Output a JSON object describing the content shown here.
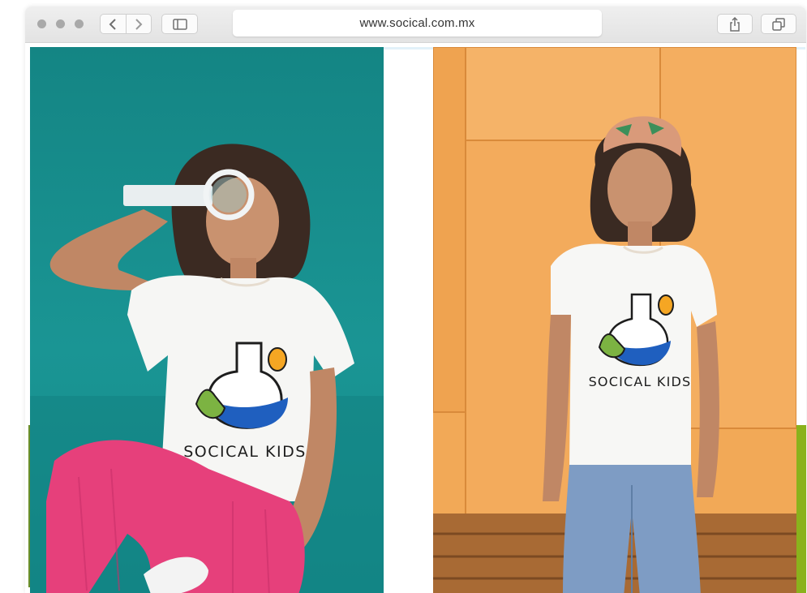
{
  "browser": {
    "url": "www.socical.com.mx",
    "icons": {
      "back": "chevron-left-icon",
      "forward": "chevron-right-icon",
      "sidebar": "sidebar-icon",
      "share": "share-icon",
      "tabs": "tabs-icon"
    }
  },
  "photos": [
    {
      "name": "girl-with-magnifier-teal-background",
      "background_color": "#148584",
      "shirt_logo_text": "SOCICAL KIDS"
    },
    {
      "name": "girl-with-bandana-orange-background",
      "background_color": "#f2a957",
      "shirt_logo_text": "SOCICAL KIDS"
    }
  ],
  "colors": {
    "teal": "#148584",
    "orange": "#f2a957",
    "logo_blue": "#1f5fbf",
    "logo_green": "#7cb342",
    "logo_orange": "#f5a623",
    "pants_pink": "#e6407b",
    "jeans_blue": "#7e9cc4"
  }
}
